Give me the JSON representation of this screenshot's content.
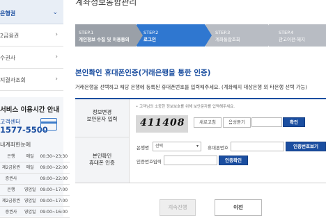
{
  "sidebar": {
    "top_item": "은행권",
    "items": [
      "2금융권",
      "수권사",
      "지결과조회"
    ],
    "service_title": "서비스 이용시간 안내",
    "call_center_label": "고객센터",
    "call_center_phone": "1577-5500",
    "sub_title": "내계좌한눈에",
    "table": [
      [
        "",
        "은행",
        "매일",
        "00:30~23:30"
      ],
      [
        "",
        "제2금융권",
        "매일",
        "09:00~22:00"
      ],
      [
        "",
        "증권사",
        "",
        "09:00~22:00"
      ],
      [
        "",
        "은행",
        "영업일",
        "09:00~17:00"
      ],
      [
        "",
        "제2금융권",
        "영업일",
        "09:00~17:00"
      ],
      [
        "",
        "증권사",
        "영업일",
        "09:00~16:00"
      ]
    ]
  },
  "page_title": "계좌정보통합관리",
  "steps": [
    {
      "num": "STEP.1",
      "name": "개인정보 수집 및 이용동의"
    },
    {
      "num": "STEP.2",
      "name": "로그인"
    },
    {
      "num": "STEP.3",
      "name": "계좌통합조회"
    },
    {
      "num": "STEP.4",
      "name": "관고이전·해지"
    }
  ],
  "section_title": "본인확인 휴대폰인증(거래은행을 통한 인증)",
  "section_desc": "거래은행을 선택하고 해당 은행에 등록된 휴대폰번호를 입력해주세요. (계좌해지 대상은행 외 타은행 선택 가능)",
  "security": {
    "label_line1": "정보변경",
    "label_line2": "보안문자 입력",
    "notice": "• 고객님의 소중한 정보보호를 위해 보안문자를 입력해주세요.",
    "captcha_text": "411408",
    "refresh_btn": "새로고침",
    "audio_btn": "음성듣기",
    "confirm_btn": "확인"
  },
  "phone": {
    "label_line1": "본인확인",
    "label_line2": "휴대폰 인증",
    "bank_label": "은행명",
    "bank_value": "선택",
    "phone_label": "휴대폰번호",
    "send_btn": "인증번호보기",
    "code_label": "인증번호입력",
    "verify_btn": "인증확인"
  },
  "bottom": {
    "continue_btn": "계속진행",
    "prev_btn": "이전"
  },
  "colors": {
    "step_done": "#9aa0a8",
    "step_active": "#2f77d0",
    "step_future": "#b8bcc3",
    "accent": "#1b4ea0"
  }
}
